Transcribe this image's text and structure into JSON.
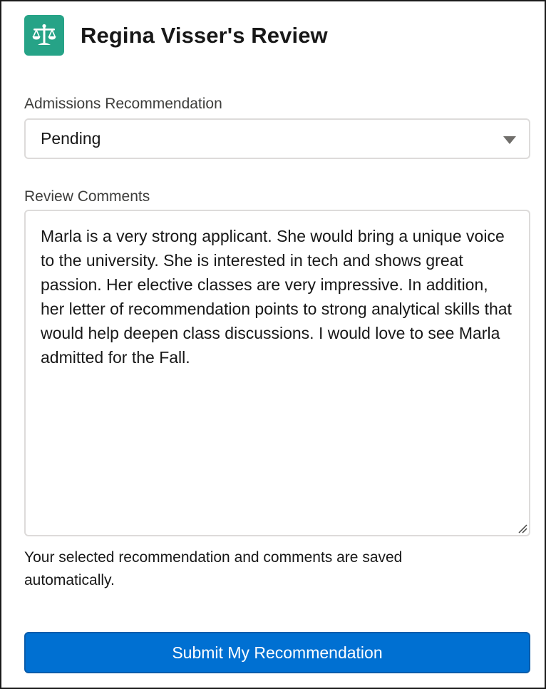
{
  "header": {
    "title": "Regina Visser's Review",
    "icon": "scales-icon",
    "icon_bg": "#26a387"
  },
  "recommendation": {
    "label": "Admissions Recommendation",
    "selected": "Pending"
  },
  "comments": {
    "label": "Review Comments",
    "value": "Marla is a very strong applicant. She would bring a unique voice to the university. She is interested in tech and shows great passion. Her elective classes are very impressive. In addition, her letter of recommendation points to strong analytical skills that would help deepen class discussions. I would love to see Marla admitted for the Fall."
  },
  "helper_text": "Your selected recommendation and comments are saved automatically.",
  "submit": {
    "label": "Submit My Recommendation",
    "color": "#0070d2"
  }
}
